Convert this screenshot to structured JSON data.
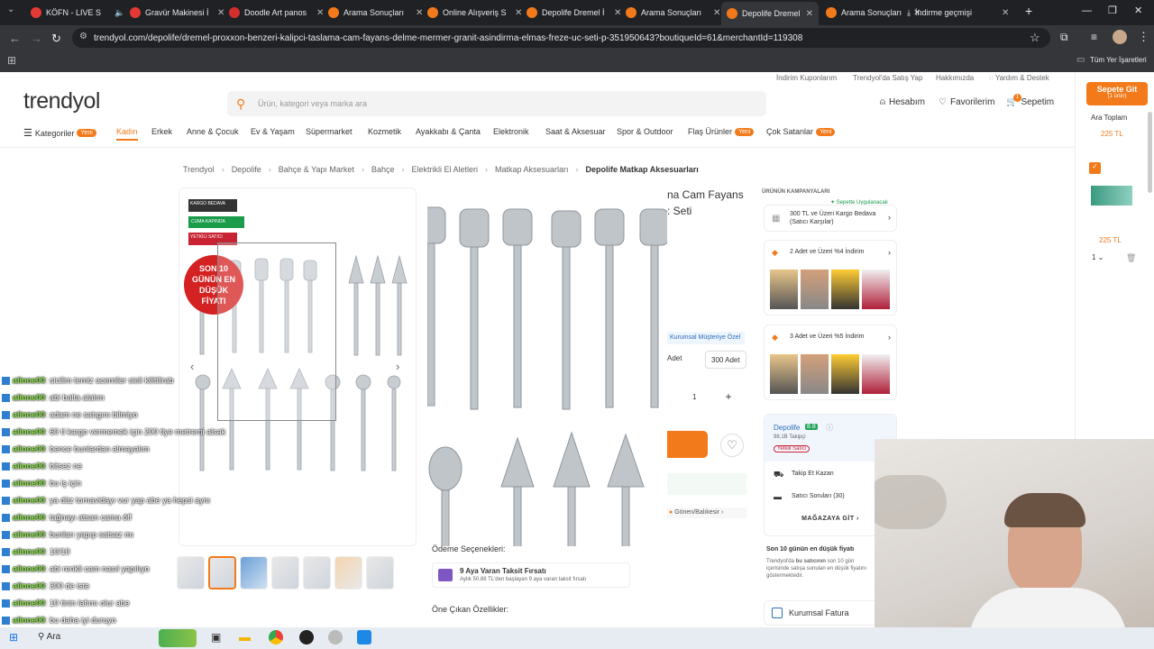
{
  "tabs": [
    {
      "title": "KÖFN - LIVE S",
      "color": "#e53935"
    },
    {
      "title": "Gravür Makinesi İ",
      "color": "#e53935"
    },
    {
      "title": "Doodle Art panos",
      "color": "#d32f2f"
    },
    {
      "title": "Arama Sonuçları",
      "color": "#f27a1a"
    },
    {
      "title": "Online Alışveriş S",
      "color": "#f27a1a"
    },
    {
      "title": "Depolife Dremel İ",
      "color": "#f27a1a"
    },
    {
      "title": "Arama Sonuçları",
      "color": "#f27a1a"
    },
    {
      "title": "Depolife Dremel İ",
      "color": "#f27a1a"
    },
    {
      "title": "Arama Sonuçları",
      "color": "#f27a1a"
    },
    {
      "title": "İndirme geçmişi",
      "color": "#9aa0a6"
    }
  ],
  "browser": {
    "url": "trendyol.com/depolife/dremel-proxxon-benzeri-kalipci-taslama-cam-fayans-delme-mermer-granit-asindirma-elmas-freze-uc-seti-p-351950643?boutiqueId=61&merchantId=119308",
    "bookmarks_all": "Tüm Yer İşaretleri"
  },
  "top_links": [
    "İndirim Kuponlarım",
    "Trendyol'da Satış Yap",
    "Hakkımızda",
    "Yardım & Destek"
  ],
  "logo": "trendyol",
  "search": {
    "placeholder": "Ürün, kategori veya marka ara"
  },
  "header": {
    "account": "Hesabım",
    "favorites": "Favorilerim",
    "cart": "Sepetim",
    "cart_count": "1"
  },
  "categories": {
    "all": "Kategoriler",
    "new": "Yeni",
    "items": [
      "Kadın",
      "Erkek",
      "Anne & Çocuk",
      "Ev & Yaşam",
      "Süpermarket",
      "Kozmetik",
      "Ayakkabı & Çanta",
      "Elektronik",
      "Saat & Aksesuar",
      "Spor & Outdoor"
    ],
    "flash": "Flaş Ürünler",
    "sale": "Çok Satanlar"
  },
  "breadcrumb": [
    "Trendyol",
    "Depolife",
    "Bahçe & Yapı Market",
    "Bahçe",
    "Elektrikli El Aletleri",
    "Matkap Aksesuarları",
    "Depolife Matkap Aksesuarları"
  ],
  "product": {
    "badges": [
      "KARGO BEDAVA",
      "CUMA KAPINDA",
      "YETKİLİ SATICI"
    ],
    "lowest_price": "SON 10 GÜNÜN EN DÜŞÜK FİYATI",
    "title_partial": "na Cam Fayans",
    "title_partial2": ": Seti",
    "corporate": "Kurumsal Müşteriye Özel",
    "qty_opts": [
      "Adet",
      "300 Adet"
    ],
    "qty": "1",
    "shipping_note": "Gönen/Balıkesir",
    "payment_title": "Ödeme Seçenekleri:",
    "installment": "9 Aya Varan Taksit Fırsatı",
    "installment_sub": "Aylık 50.88 TL'den başlayan 9 aya varan taksit fırsatı",
    "features_title": "Öne Çıkan Özellikler:"
  },
  "campaigns": {
    "title": "ÜRÜNÜN KAMPANYALARI",
    "tag": "Sepette Uygulanacak",
    "c1": "300 TL ve Üzeri Kargo Bedava (Satıcı Karşılar)",
    "c2": "2 Adet ve Üzeri %4 İndirim",
    "c3": "3 Adet ve Üzeri %5 İndirim"
  },
  "seller": {
    "name": "Depolife",
    "score": "8.8",
    "followers": "98,1B Takipçi",
    "official": "Yetkili Satıcı",
    "follow_earn": "Takip Et Kazan",
    "questions": "Satıcı Soruları (30)",
    "store": "MAĞAZAYA GİT"
  },
  "lowest_info": {
    "title": "Son 10 günün en düşük fiyatı",
    "text1": "Trendyol'da",
    "text2": "bu satıcının",
    "text3": "son 10 gün içerisinde satışa sunulan en düşük fiyatını göstermektedir."
  },
  "invoice": "Kurumsal Fatura",
  "cart_panel": {
    "go": "Sepete Git",
    "count": "(1 ürün)",
    "subtotal_label": "Ara Toplam",
    "subtotal": "225 TL",
    "price": "225 TL",
    "qty": "1"
  },
  "chat": [
    {
      "user": "alinne00",
      "msg": ": sicilim temiz acemiler sieli kilitilirab"
    },
    {
      "user": "alinne00",
      "msg": ": abi balta alalım"
    },
    {
      "user": "alinne00",
      "msg": ": adam ne satıgını bilmiyo"
    },
    {
      "user": "alinne00",
      "msg": ": 60 tl kargo vermemek için 200 tlye metremi alsak"
    },
    {
      "user": "alinne00",
      "msg": ": bence bunlardan almayalım"
    },
    {
      "user": "alinne00",
      "msg": ": bitsez ne"
    },
    {
      "user": "alinne00",
      "msg": ": bu iş için"
    },
    {
      "user": "alinne00",
      "msg": ": ya düz tornavidayı vur yap abe ya hepsi aynı"
    },
    {
      "user": "alinne00",
      "msg": ": tağnayı atsan cama öff"
    },
    {
      "user": "alinne00",
      "msg": ": bunları yapıp satsaz mı"
    },
    {
      "user": "alinne00",
      "msg": ": 10/10"
    },
    {
      "user": "alinne00",
      "msg": ": abi renkli cam nasıl yapılıyo"
    },
    {
      "user": "alinne00",
      "msg": ": 300 de iste"
    },
    {
      "user": "alinne00",
      "msg": ": 10 tinin lafımı olur abe"
    },
    {
      "user": "alinne00",
      "msg": ": bu daha iyi duruyo"
    }
  ],
  "taskbar": {
    "search": "Ara"
  }
}
